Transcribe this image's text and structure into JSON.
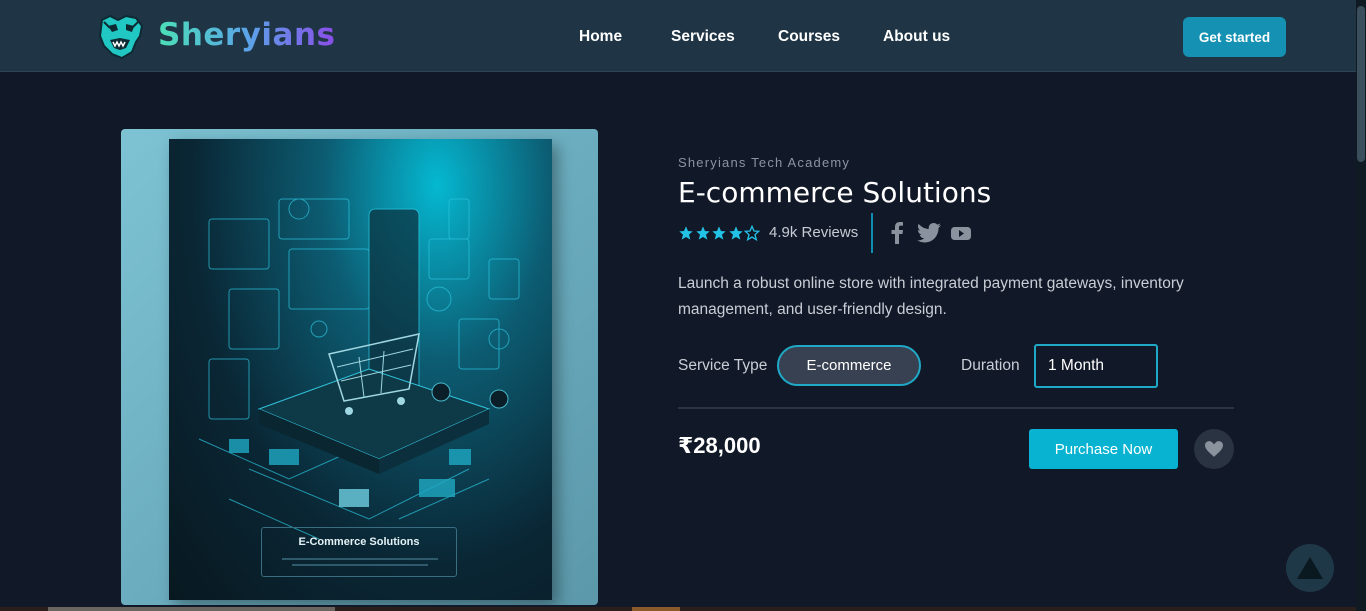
{
  "brand": {
    "name": "Sheryians"
  },
  "nav": {
    "links": [
      "Home",
      "Services",
      "Courses",
      "About us"
    ],
    "cta": "Get started"
  },
  "product": {
    "image_caption": "E-Commerce Solutions",
    "academy": "Sheryians Tech Academy",
    "title": "E-commerce Solutions",
    "rating": 4.5,
    "rating_max": 5,
    "reviews": "4.9k Reviews",
    "social_icons": [
      "facebook-icon",
      "twitter-icon",
      "youtube-icon"
    ],
    "description": "Launch a robust online store with integrated payment gateways, inventory management, and user-friendly design.",
    "service_type_label": "Service Type",
    "service_type_value": "E-commerce",
    "duration_label": "Duration",
    "duration_value": "1 Month",
    "price": "₹28,000",
    "purchase_label": "Purchase Now"
  },
  "colors": {
    "accent": "#08b3d1",
    "star": "#22c1e6",
    "background": "#111827",
    "navbar": "#1f3545"
  }
}
